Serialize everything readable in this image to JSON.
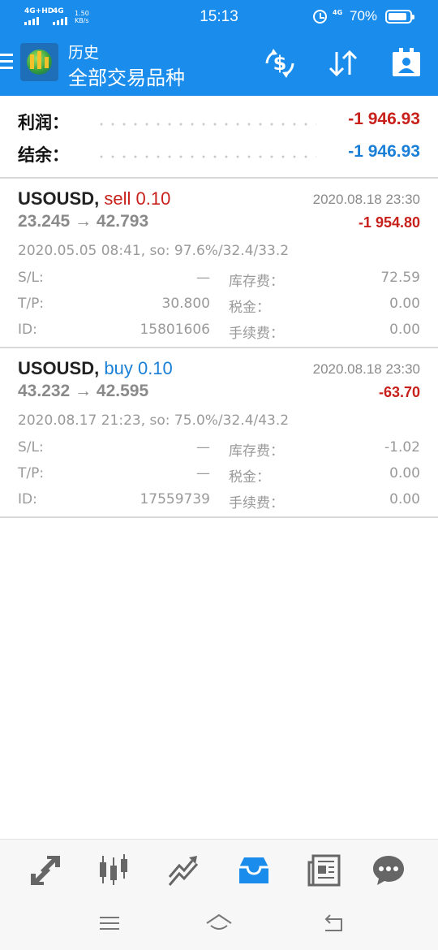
{
  "status_bar": {
    "sim1_label": "4G+HD",
    "sim2_label": "4G",
    "speed_value": "1.50",
    "speed_unit": "KB/s",
    "time": "15:13",
    "net_label": "4G",
    "battery": "70%"
  },
  "header": {
    "title_small": "历史",
    "title_main": "全部交易品种",
    "icons": [
      "menu-icon",
      "app-logo",
      "currency-exchange-icon",
      "sort-icon",
      "contact-icon"
    ]
  },
  "summary": {
    "profit_label": "利润：",
    "profit_value": "-1 946.93",
    "balance_label": "结余：",
    "balance_value": "-1 946.93",
    "colors": {
      "profit": "#c8201b",
      "balance": "#1a7fd6"
    }
  },
  "labels": {
    "sl": "S/L:",
    "tp": "T/P:",
    "id": "ID:",
    "swap": "库存费：",
    "tax": "税金：",
    "commission": "手续费："
  },
  "trades": [
    {
      "symbol": "USOUSD,",
      "side": "sell 0.10",
      "time": "2020.08.18 23:30",
      "prices": "23.245 → 42.793",
      "profit": "-1 954.80",
      "info": "2020.05.05 08:41, so: 97.6%/32.4/33.2",
      "sl": "—",
      "tp": "30.800",
      "id": "15801606",
      "swap": "72.59",
      "tax": "0.00",
      "commission": "0.00"
    },
    {
      "symbol": "USOUSD,",
      "side": "buy 0.10",
      "time": "2020.08.18 23:30",
      "prices": "43.232 → 42.595",
      "profit": "-63.70",
      "info": "2020.08.17 21:23, so: 75.0%/32.4/43.2",
      "sl": "—",
      "tp": "—",
      "id": "17559739",
      "swap": "-1.02",
      "tax": "0.00",
      "commission": "0.00"
    }
  ],
  "bottom_nav": {
    "items": [
      "quotes-icon",
      "chart-icon",
      "trade-icon",
      "history-icon",
      "news-icon",
      "chat-icon"
    ],
    "active": "history-icon",
    "active_color": "#1a8cec"
  },
  "system_nav": [
    "menu-icon",
    "home-icon",
    "back-icon"
  ]
}
